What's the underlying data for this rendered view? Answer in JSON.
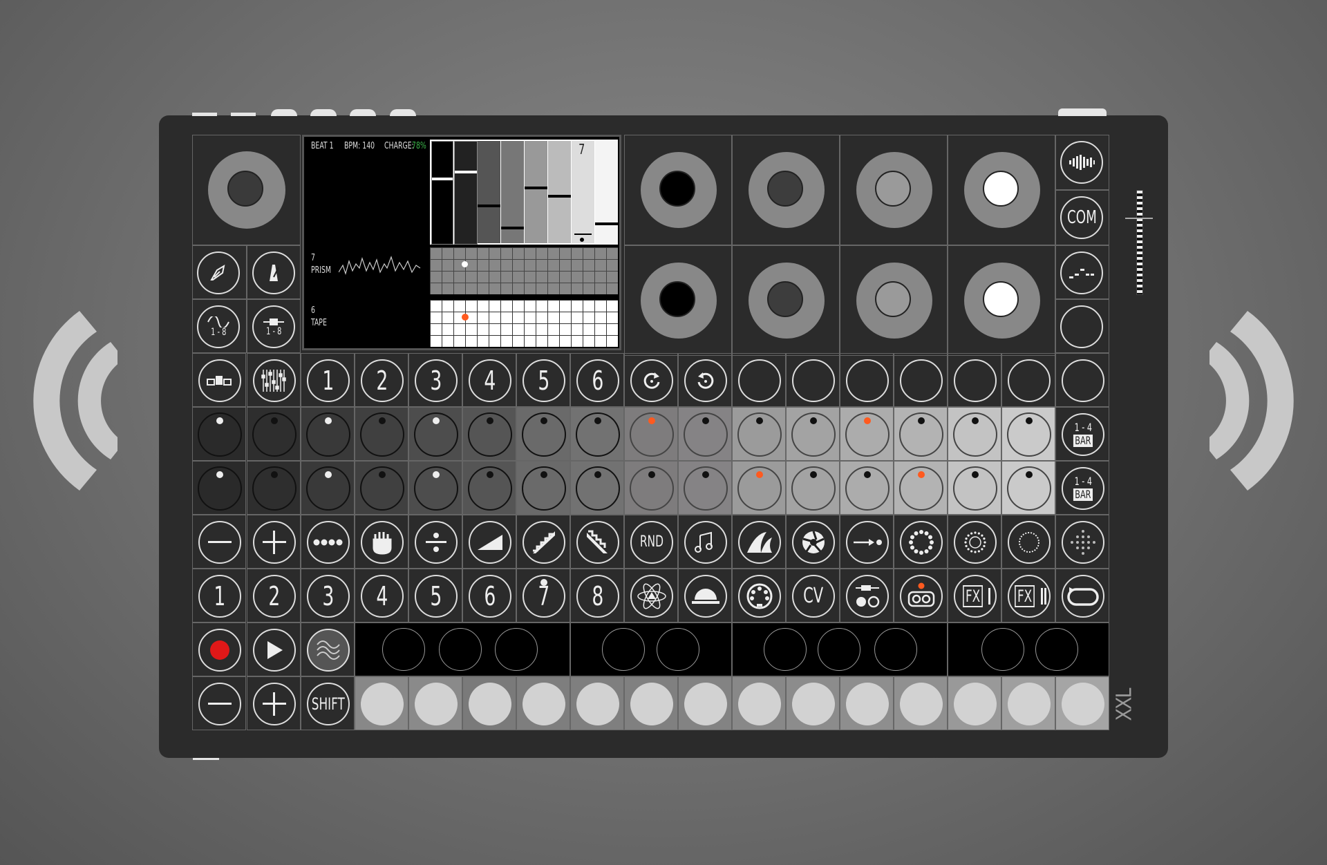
{
  "colors": {
    "accent_orange": "#ff5a1f",
    "record_red": "#e01818",
    "pad_light": "#d2d2d2",
    "body": "#2b2b2b"
  },
  "display": {
    "beat": "BEAT 1",
    "bpm": "BPM: 140",
    "charge": "CHARGE:",
    "charge_value": "78%",
    "track_a_num": "7",
    "track_a_name": "PRISM",
    "track_b_num": "6",
    "track_b_name": "TAPE",
    "bar_label": "7"
  },
  "track_buttons": [
    "1",
    "2",
    "3",
    "4",
    "5",
    "6"
  ],
  "function_icons": [
    "minus-icon",
    "plus-icon",
    "dots-icon",
    "hand-icon",
    "divide-icon",
    "ramp-icon",
    "stairs-up-icon",
    "stairs-down-icon",
    "rnd-button",
    "notes-icon",
    "fin-icon",
    "aperture-icon",
    "arrow-dot-icon",
    "ring-dots-icon",
    "ring-dots-small-icon",
    "ring-dashed-icon",
    "dot-grid-icon"
  ],
  "rnd_label": "RND",
  "number_row": [
    "1",
    "2",
    "3",
    "4",
    "5",
    "6",
    "7",
    "8"
  ],
  "cv_label": "CV",
  "fx1_label": "FX",
  "fx2_label": "FX",
  "bar_range": "1 - 4",
  "bar_word": "BAR",
  "com_label": "COM",
  "shift_label": "SHIFT",
  "model_label": "XXL"
}
